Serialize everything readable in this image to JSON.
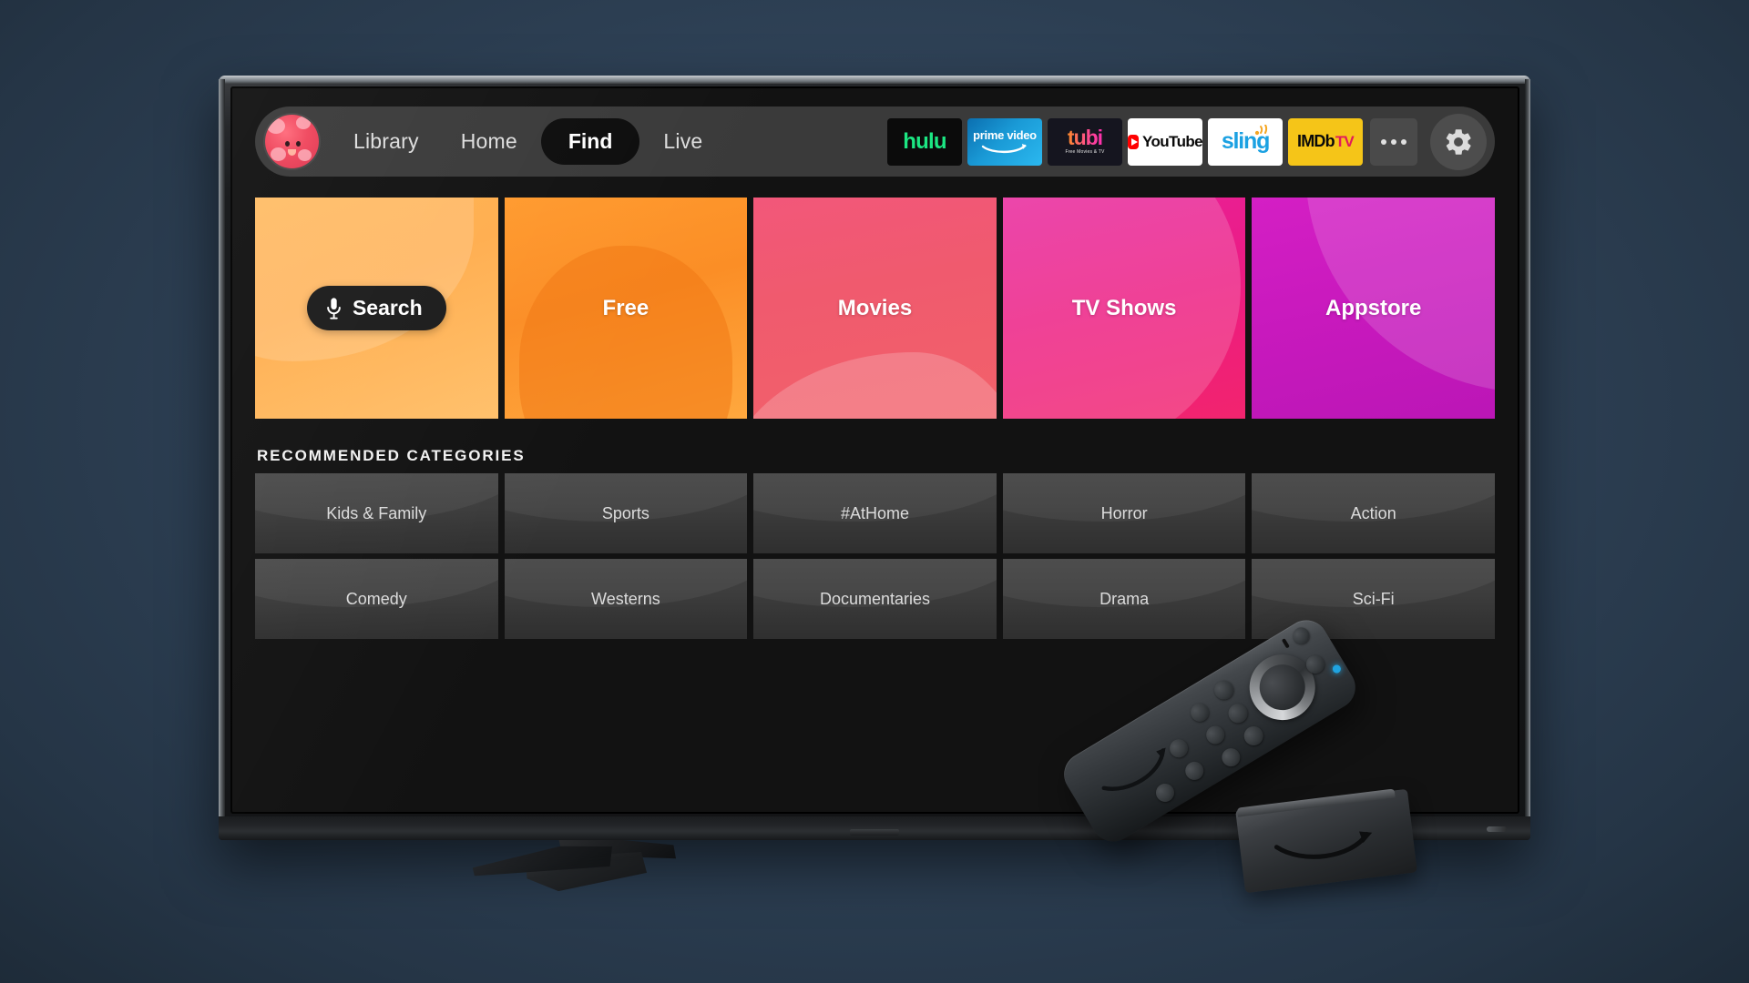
{
  "device": {
    "name": "fire-tv",
    "background_color": "#2f4257",
    "screen_background": "#121212"
  },
  "nav": {
    "avatar_label": "profile-avatar",
    "links": [
      {
        "label": "Library",
        "selected": false
      },
      {
        "label": "Home",
        "selected": false
      },
      {
        "label": "Find",
        "selected": true
      },
      {
        "label": "Live",
        "selected": false
      }
    ],
    "apps": [
      {
        "name": "hulu",
        "text": "hulu",
        "bg": "#0b0b0b",
        "fg": "#1ce783"
      },
      {
        "name": "prime-video",
        "text": "prime video",
        "bg": "#1a9ad6",
        "fg": "#ffffff"
      },
      {
        "name": "tubi",
        "text": "tubi",
        "subtitle": "Free Movies & TV",
        "bg": "#15151f",
        "fg": "#ff4f8b"
      },
      {
        "name": "youtube",
        "text": "YouTube",
        "bg": "#ffffff",
        "fg": "#0a0a0a"
      },
      {
        "name": "sling",
        "text": "sling",
        "bg": "#ffffff",
        "fg": "#1ba1e2"
      },
      {
        "name": "imdb-tv",
        "text": "IMDb",
        "text2": "TV",
        "bg": "#f5c518",
        "fg": "#0a0a0a"
      }
    ],
    "overflow_label": "More",
    "settings_label": "Settings"
  },
  "features": [
    {
      "label": "Search",
      "has_mic": true,
      "accent": "#ffb24d"
    },
    {
      "label": "Free",
      "has_mic": false,
      "accent": "#fb8e26"
    },
    {
      "label": "Movies",
      "has_mic": false,
      "accent": "#f05a6e"
    },
    {
      "label": "TV Shows",
      "has_mic": false,
      "accent": "#ec1b82"
    },
    {
      "label": "Appstore",
      "has_mic": false,
      "accent": "#c819bd"
    }
  ],
  "categories": {
    "heading": "RECOMMENDED CATEGORIES",
    "items": [
      "Kids & Family",
      "Sports",
      "#AtHome",
      "Horror",
      "Action",
      "Comedy",
      "Westerns",
      "Documentaries",
      "Drama",
      "Sci-Fi"
    ]
  }
}
